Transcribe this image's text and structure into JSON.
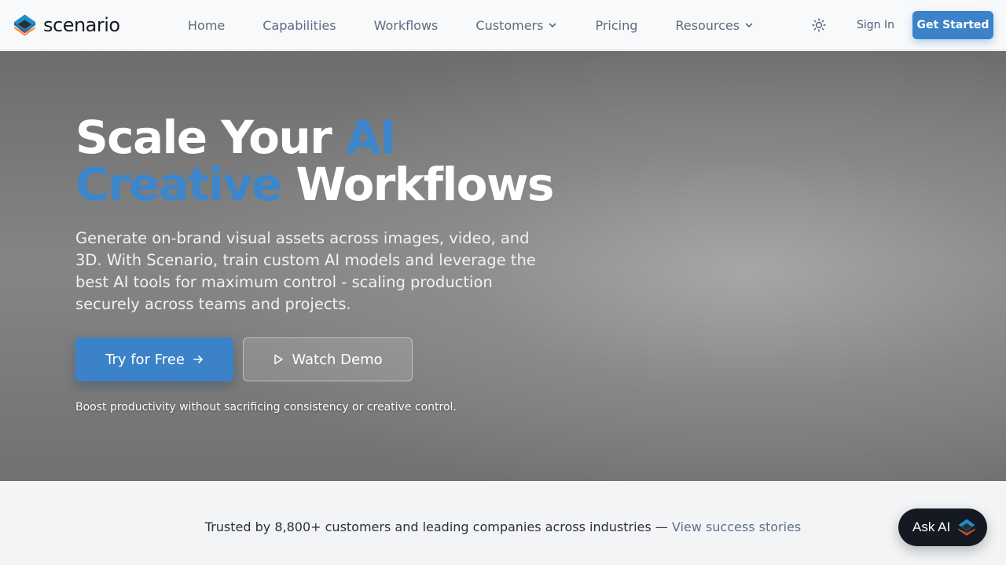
{
  "brand": {
    "name": "scenario"
  },
  "nav": {
    "items": [
      {
        "label": "Home"
      },
      {
        "label": "Capabilities"
      },
      {
        "label": "Workflows"
      },
      {
        "label": "Customers",
        "dropdown": true
      },
      {
        "label": "Pricing"
      },
      {
        "label": "Resources",
        "dropdown": true
      }
    ],
    "theme_icon": "sun-icon",
    "sign_in": "Sign In",
    "get_started": "Get Started"
  },
  "hero": {
    "title_part1": "Scale Your ",
    "title_accent1": "AI",
    "title_accent2": "Creative",
    "title_part2": " Workflows",
    "description": "Generate on-brand visual assets across images, video, and 3D. With Scenario, train custom AI models and leverage the best AI tools for maximum control - scaling production securely across teams and projects.",
    "primary_cta": "Try for Free",
    "secondary_cta": "Watch Demo",
    "note": "Boost productivity without sacrificing consistency or creative control."
  },
  "trusted": {
    "text": "Trusted by 8,800+ customers and leading companies across industries — ",
    "link": "View success stories"
  },
  "ask_ai": {
    "label": "Ask AI"
  },
  "colors": {
    "accent": "#3b82c8",
    "text_muted": "#5d6b82",
    "dark": "#151a22"
  }
}
